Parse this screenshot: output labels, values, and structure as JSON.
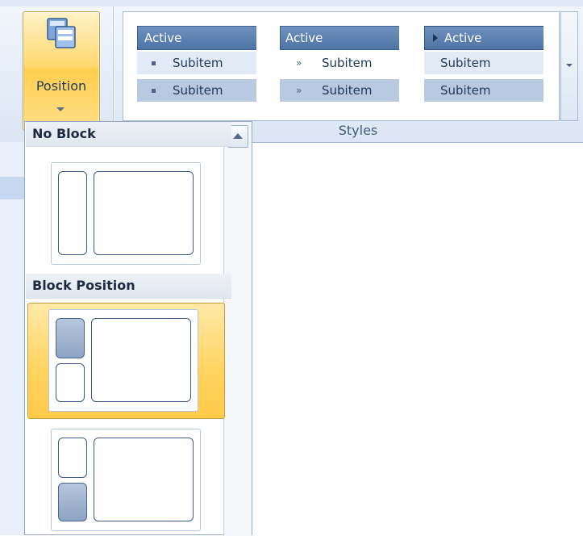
{
  "ribbon": {
    "position_button": {
      "label": "Position"
    },
    "styles_group_label": "Styles",
    "style_options": [
      {
        "active_label": "Active",
        "subitems": [
          "Subitem",
          "Subitem"
        ],
        "bullet": "square"
      },
      {
        "active_label": "Active",
        "subitems": [
          "Subitem",
          "Subitem"
        ],
        "bullet": "double-chevron"
      },
      {
        "active_label": "Active",
        "subitems": [
          "Subitem",
          "Subitem"
        ],
        "bullet": "triangle-on-active"
      }
    ]
  },
  "dropdown": {
    "sections": [
      {
        "header": "No Block",
        "options": [
          {
            "name": "no-block",
            "selected": false
          }
        ]
      },
      {
        "header": "Block Position",
        "options": [
          {
            "name": "block-top",
            "selected": true
          },
          {
            "name": "block-bottom",
            "selected": false
          }
        ]
      }
    ]
  },
  "colors": {
    "accent_selected": "#ffd35e",
    "ribbon_bg": "#e4ecf7",
    "active_item": "#4e74a6",
    "text": "#1e395b"
  }
}
